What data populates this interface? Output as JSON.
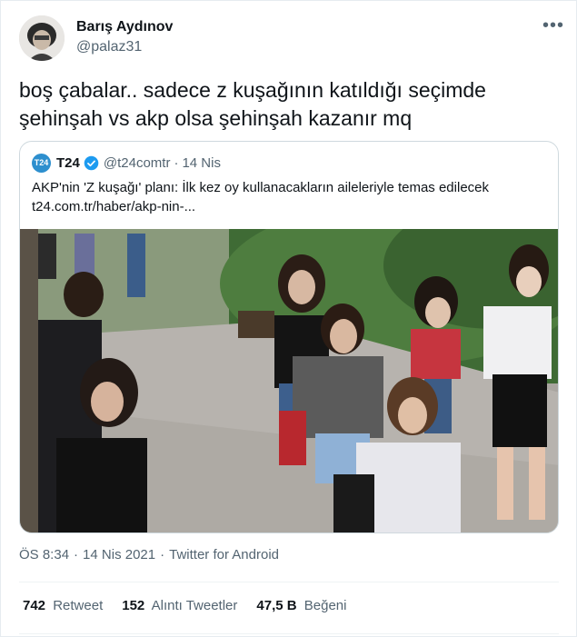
{
  "author": {
    "name": "Barış Aydınov",
    "handle": "@palaz31"
  },
  "more_label": "•••",
  "tweet": {
    "line1": "boş çabalar.. sadece z kuşağının katıldığı seçimde",
    "line2": "şehinşah vs akp olsa şehinşah kazanır mq"
  },
  "quote": {
    "logo_text": "T24",
    "name": "T24",
    "handle": "@t24comtr",
    "separator": "·",
    "date": "14 Nis",
    "text_line1": "AKP'nin 'Z kuşağı' planı: İlk kez oy kullanacakların aileleriyle temas edilecek",
    "text_line2": "t24.com.tr/haber/akp-nin-..."
  },
  "meta": {
    "time": "ÖS 8:34",
    "sep1": "·",
    "date": "14 Nis 2021",
    "sep2": "·",
    "source": "Twitter for Android"
  },
  "stats": {
    "retweets_count": "742",
    "retweets_label": "Retweet",
    "quotes_count": "152",
    "quotes_label": "Alıntı Tweetler",
    "likes_count": "47,5 B",
    "likes_label": "Beğeni"
  },
  "colors": {
    "brand_blue": "#1d9bf0",
    "secondary_text": "#536471",
    "primary_text": "#0f1419"
  }
}
